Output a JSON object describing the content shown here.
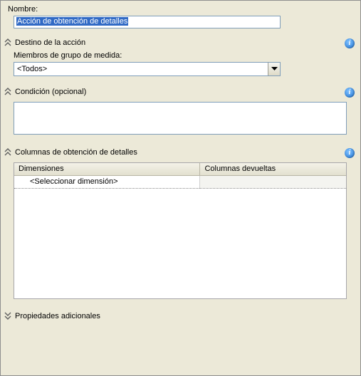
{
  "name_section": {
    "label": "Nombre:",
    "value": "Acción de obtención de detalles"
  },
  "destino": {
    "header": "Destino de la acción",
    "miembros_label": "Miembros de grupo de medida:",
    "combo_value": "<Todos>"
  },
  "condicion": {
    "header": "Condición (opcional)",
    "value": ""
  },
  "columnas": {
    "header": "Columnas de obtención de detalles",
    "col1": "Dimensiones",
    "col2": "Columnas devueltas",
    "row1_dim": "<Seleccionar dimensión>",
    "row1_ret": ""
  },
  "propiedades": {
    "header": "Propiedades adicionales"
  }
}
